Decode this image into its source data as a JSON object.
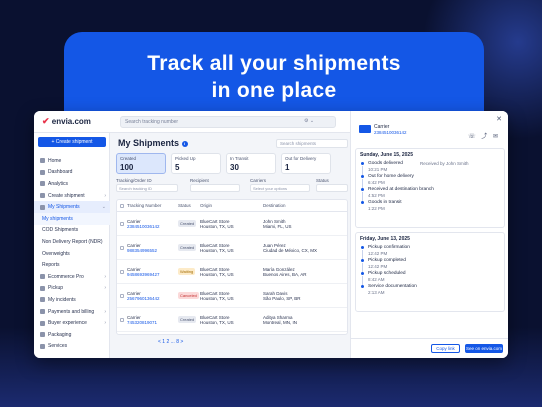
{
  "headline": {
    "line1": "Track all your shipments",
    "line2": "in one place"
  },
  "topbar": {
    "logo": "envia.com",
    "search_placeholder": "Search tracking number"
  },
  "sidebar": {
    "create_button": "+ Create shipment",
    "items": [
      {
        "label": "Home"
      },
      {
        "label": "Dashboard"
      },
      {
        "label": "Analytics"
      },
      {
        "label": "Create shipment"
      },
      {
        "label": "My Shipments"
      },
      {
        "label": "My shipments"
      },
      {
        "label": "COD Shipments"
      },
      {
        "label": "Non Delivery Report (NDR)"
      },
      {
        "label": "Overweights"
      },
      {
        "label": "Reports"
      },
      {
        "label": "Ecommerce Pro"
      },
      {
        "label": "Pickup"
      },
      {
        "label": "My incidents"
      },
      {
        "label": "Payments and billing"
      },
      {
        "label": "Buyer experience"
      },
      {
        "label": "Packaging"
      },
      {
        "label": "Services"
      }
    ]
  },
  "main": {
    "title": "My Shipments",
    "search_placeholder": "Search shipments",
    "stats": [
      {
        "label": "Created",
        "value": "100"
      },
      {
        "label": "Picked Up",
        "value": "5"
      },
      {
        "label": "In Transit",
        "value": "30"
      },
      {
        "label": "Out for Delivery",
        "value": "1"
      }
    ],
    "filters": {
      "tracking_label": "Tracking/Order ID",
      "tracking_placeholder": "Search tracking ID",
      "recipient_label": "Recipient",
      "carriers_label": "Carriers",
      "carriers_placeholder": "Select your options",
      "status_label": "Status"
    },
    "columns": [
      "Tracking Number",
      "Status",
      "Origin",
      "Destination"
    ],
    "rows": [
      {
        "carrier": "Carrier",
        "tracking": "2384510036142",
        "status": "Created",
        "origin": "BlueCart Store",
        "origin_city": "Houston, TX, US",
        "dest": "John Smith",
        "dest_city": "Miami, FL, US"
      },
      {
        "carrier": "Carrier",
        "tracking": "988354996552",
        "status": "Created",
        "origin": "BlueCart Store",
        "origin_city": "Houston, TX, US",
        "dest": "Juan Pérez",
        "dest_city": "Ciudad de México, CX, MX"
      },
      {
        "carrier": "Carrier",
        "tracking": "9458693969427",
        "status": "Waiting",
        "origin": "BlueCart Store",
        "origin_city": "Houston, TX, US",
        "dest": "María González",
        "dest_city": "Buenos Aires, BA, AR"
      },
      {
        "carrier": "Carrier",
        "tracking": "2567960136442",
        "status": "Canceled",
        "origin": "BlueCart Store",
        "origin_city": "Houston, TX, US",
        "dest": "Sarah Davis",
        "dest_city": "São Paulo, SP, BR"
      },
      {
        "carrier": "Carrier",
        "tracking": "745320819071",
        "status": "Created",
        "origin": "BlueCart Store",
        "origin_city": "Houston, TX, US",
        "dest": "Aditya Sharma",
        "dest_city": "Montreal, MN, IN"
      }
    ],
    "pager": "< 1 2 ... 8 >"
  },
  "panel": {
    "carrier_label": "Carrier",
    "tracking": "2384510036142",
    "groups": [
      {
        "date": "Sunday, June 15, 2025",
        "events": [
          {
            "name": "Goods delivered",
            "time": "10:21 PM",
            "note": "Received by John Smith"
          },
          {
            "name": "Out for home delivery",
            "time": "6:42 PM",
            "note": ""
          },
          {
            "name": "Received at destination branch",
            "time": "4:52 PM",
            "note": ""
          },
          {
            "name": "Goods in transit",
            "time": "1:22 PM",
            "note": ""
          }
        ]
      },
      {
        "date": "Friday, June 13, 2025",
        "events": [
          {
            "name": "Pickup confirmation",
            "time": "12:42 PM",
            "note": ""
          },
          {
            "name": "Pickup completed",
            "time": "12:42 PM",
            "note": ""
          },
          {
            "name": "Pickup scheduled",
            "time": "8:42 AM",
            "note": ""
          },
          {
            "name": "Service documentation",
            "time": "2:13 AM",
            "note": ""
          }
        ]
      }
    ],
    "copy_button": "Copy link",
    "see_button": "See on envia.com"
  }
}
